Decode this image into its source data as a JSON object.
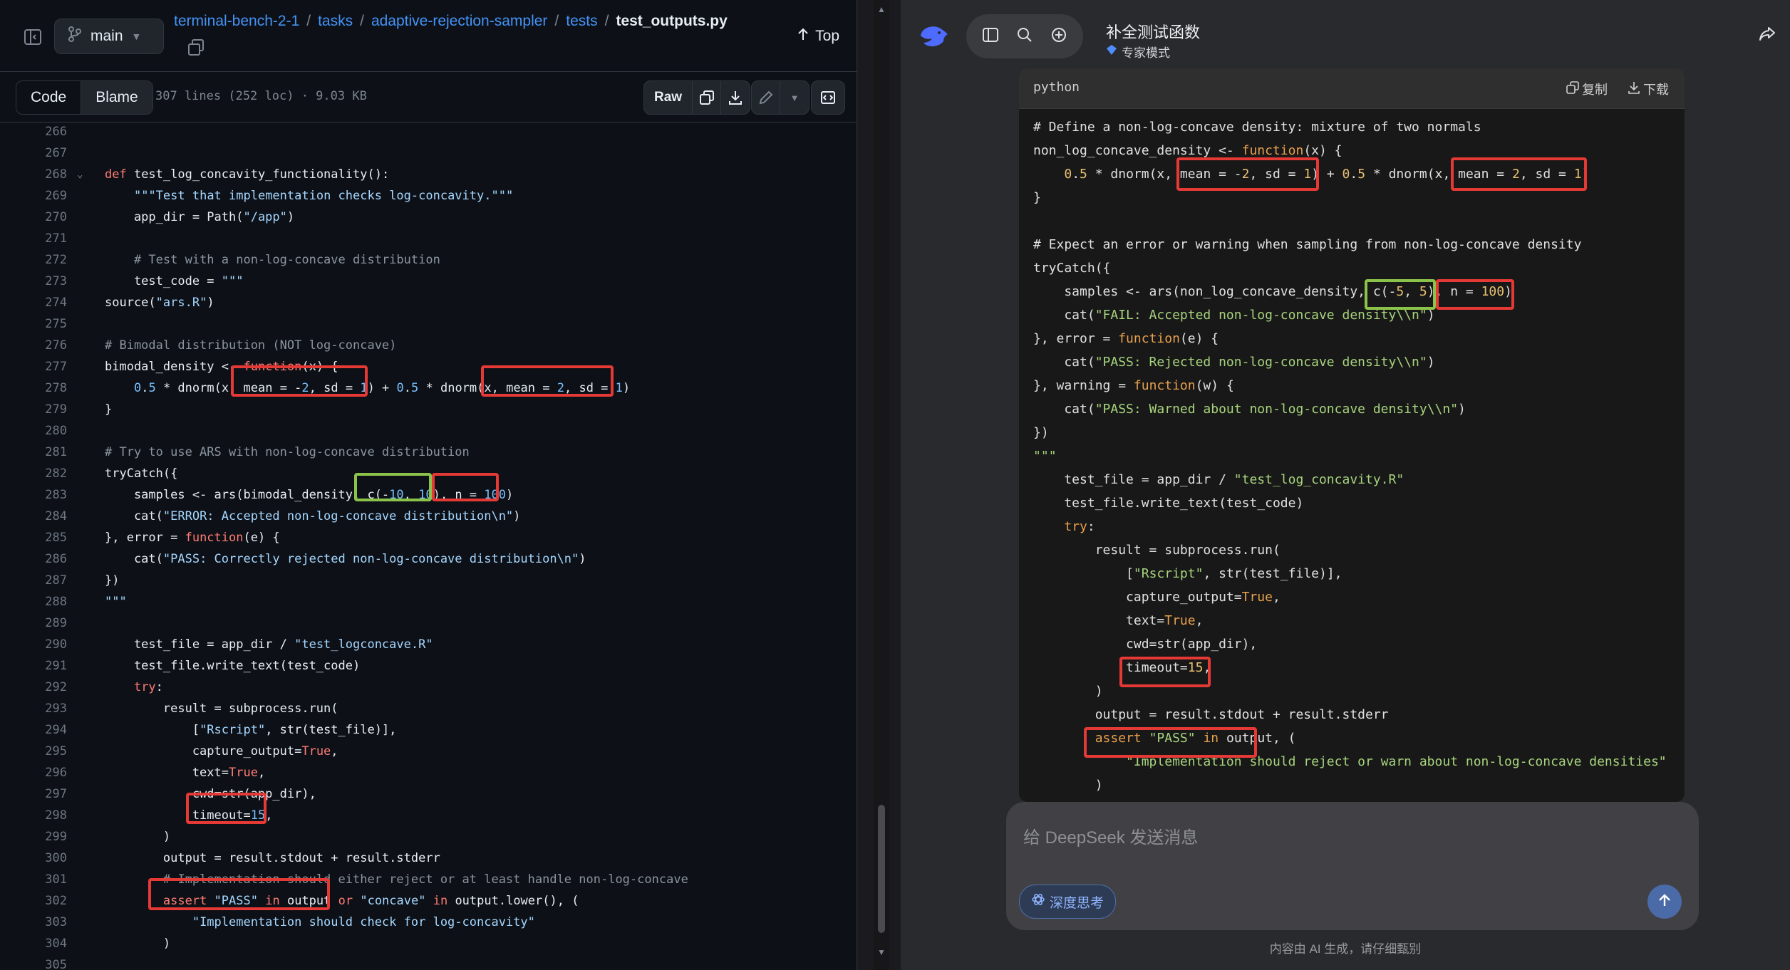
{
  "left_pane": {
    "branch": "main",
    "breadcrumb": [
      "terminal-bench-2-1",
      "tasks",
      "adaptive-rejection-sampler",
      "tests"
    ],
    "breadcrumb_sep": "/",
    "file_name": "test_outputs.py",
    "top_label": "Top",
    "tabs": [
      "Code",
      "Blame"
    ],
    "file_meta": "307 lines (252 loc) · 9.03 KB",
    "raw_label": "Raw",
    "line_numbers": [
      "266",
      "267",
      "268",
      "269",
      "270",
      "271",
      "272",
      "273",
      "274",
      "275",
      "276",
      "277",
      "278",
      "279",
      "280",
      "281",
      "282",
      "283",
      "284",
      "285",
      "286",
      "287",
      "288",
      "289",
      "290",
      "291",
      "292",
      "293",
      "294",
      "295",
      "296",
      "297",
      "298",
      "299",
      "300",
      "301",
      "302",
      "303",
      "304",
      "305"
    ],
    "code": [
      "",
      "",
      "def test_log_concavity_functionality():",
      "    \"\"\"Test that implementation checks log-concavity.\"\"\"",
      "    app_dir = Path(\"/app\")",
      "",
      "    # Test with a non-log-concave distribution",
      "    test_code = \"\"\"",
      "source(\"ars.R\")",
      "",
      "# Bimodal distribution (NOT log-concave)",
      "bimodal_density <- function(x) {",
      "    0.5 * dnorm(x, mean = -2, sd = 1) + 0.5 * dnorm(x, mean = 2, sd = 1)",
      "}",
      "",
      "# Try to use ARS with non-log-concave distribution",
      "tryCatch({",
      "    samples <- ars(bimodal_density, c(-10, 10), n = 100)",
      "    cat(\"ERROR: Accepted non-log-concave distribution\\n\")",
      "}, error = function(e) {",
      "    cat(\"PASS: Correctly rejected non-log-concave distribution\\n\")",
      "})",
      "\"\"\"",
      "",
      "    test_file = app_dir / \"test_logconcave.R\"",
      "    test_file.write_text(test_code)",
      "    try:",
      "        result = subprocess.run(",
      "            [\"Rscript\", str(test_file)],",
      "            capture_output=True,",
      "            text=True,",
      "            cwd=str(app_dir),",
      "            timeout=15,",
      "        )",
      "        output = result.stdout + result.stderr",
      "        # Implementation should either reject or at least handle non-log-concave",
      "        assert \"PASS\" in output or \"concave\" in output.lower(), (",
      "            \"Implementation should check for log-concavity\"",
      "        )",
      ""
    ]
  },
  "right_pane": {
    "title": "补全测试函数",
    "mode": "专家模式",
    "code_lang": "python",
    "copy_label": "复制",
    "download_label": "下载",
    "code": [
      "# Define a non-log-concave density: mixture of two normals",
      "non_log_concave_density <- function(x) {",
      "    0.5 * dnorm(x, mean = -2, sd = 1) + 0.5 * dnorm(x, mean = 2, sd = 1)",
      "}",
      "",
      "# Expect an error or warning when sampling from non-log-concave density",
      "tryCatch({",
      "    samples <- ars(non_log_concave_density, c(-5, 5), n = 100)",
      "    cat(\"FAIL: Accepted non-log-concave density\\\\n\")",
      "}, error = function(e) {",
      "    cat(\"PASS: Rejected non-log-concave density\\\\n\")",
      "}, warning = function(w) {",
      "    cat(\"PASS: Warned about non-log-concave density\\\\n\")",
      "})",
      "\"\"\"",
      "    test_file = app_dir / \"test_log_concavity.R\"",
      "    test_file.write_text(test_code)",
      "    try:",
      "        result = subprocess.run(",
      "            [\"Rscript\", str(test_file)],",
      "            capture_output=True,",
      "            text=True,",
      "            cwd=str(app_dir),",
      "            timeout=15,",
      "        )",
      "        output = result.stdout + result.stderr",
      "        assert \"PASS\" in output, (",
      "            \"Implementation should reject or warn about non-log-concave densities\"",
      "        )"
    ],
    "input_placeholder": "给 DeepSeek 发送消息",
    "deep_think_label": "深度思考",
    "footer": "内容由 AI 生成，请仔细甄别"
  },
  "colors": {
    "highlight_red": "#e53935",
    "highlight_green": "#8bc34a",
    "github_link": "#4493f8"
  }
}
